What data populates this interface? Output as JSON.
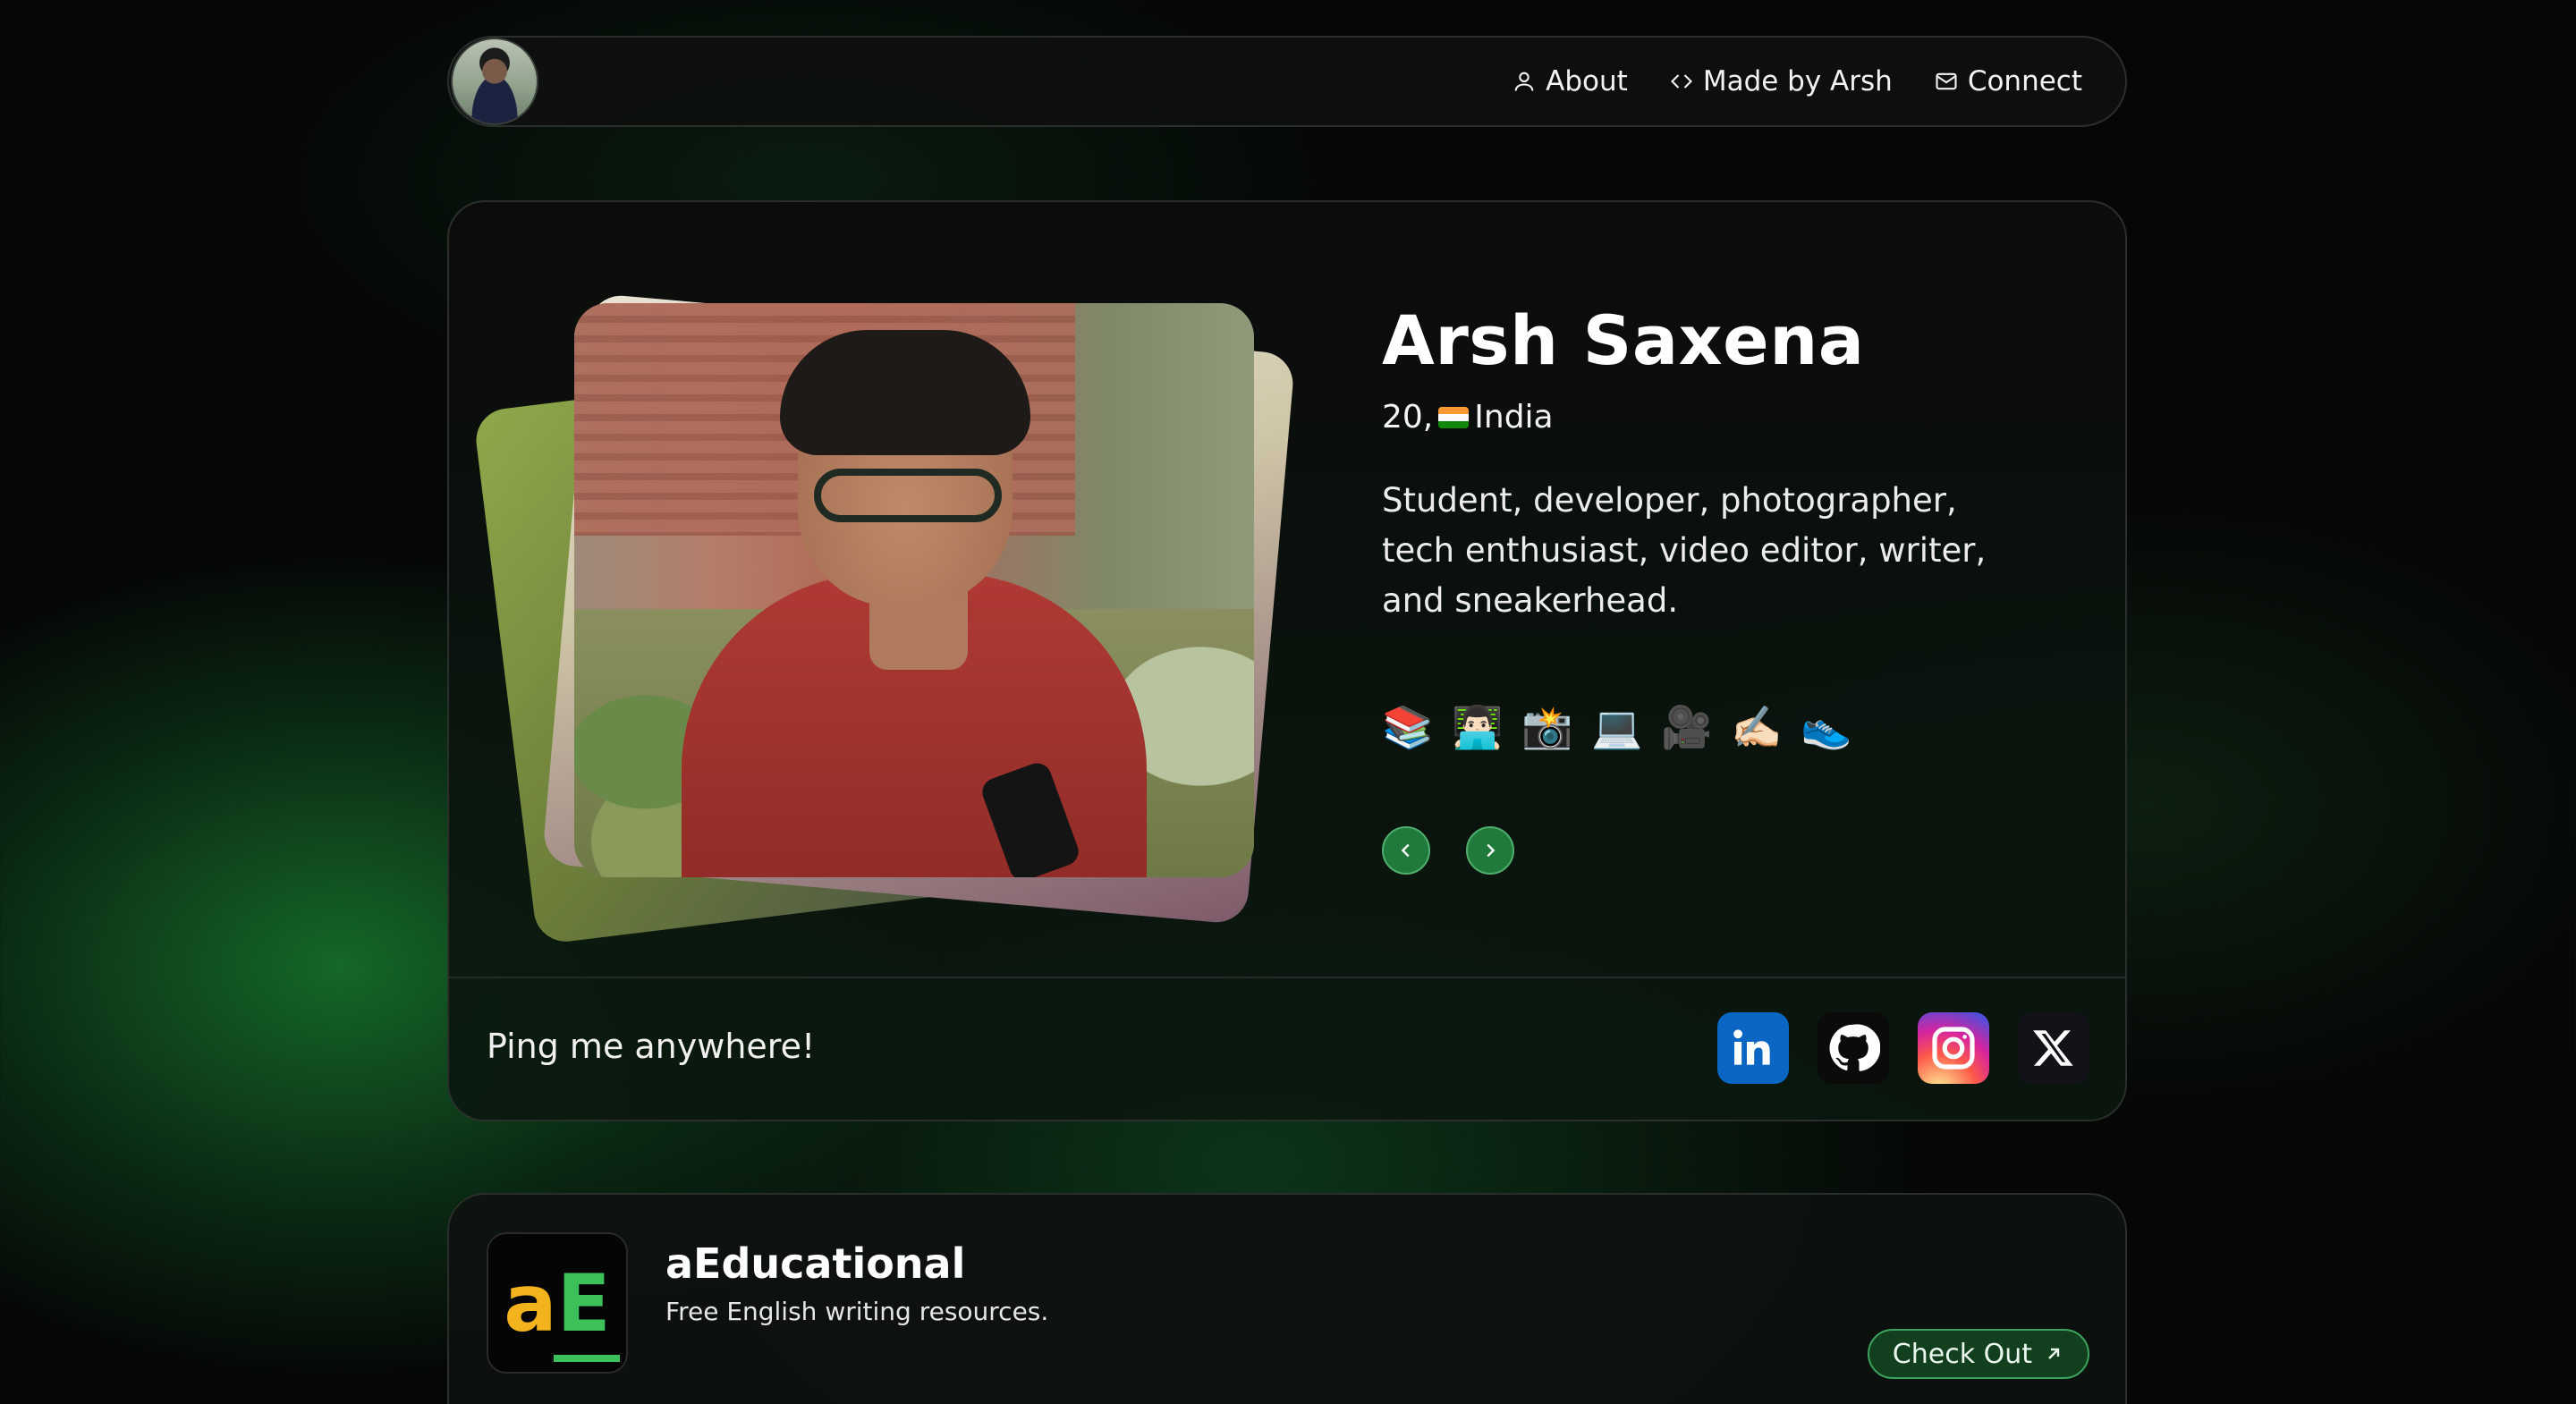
{
  "nav": {
    "avatar_alt": "avatar",
    "links": [
      {
        "label": "About",
        "icon": "user-icon"
      },
      {
        "label": "Made by Arsh",
        "icon": "code-icon"
      },
      {
        "label": "Connect",
        "icon": "mail-icon"
      }
    ]
  },
  "profile": {
    "name": "Arsh Saxena",
    "age_prefix": "20,",
    "country": "India",
    "bio": "Student, developer, photographer, tech enthusiast, video editor, writer, and sneakerhead.",
    "emojis": [
      "📚",
      "👨🏻‍💻",
      "📸",
      "💻",
      "🎥",
      "✍🏻",
      "👟"
    ]
  },
  "connect": {
    "label": "Ping me anywhere!",
    "socials": [
      {
        "name": "LinkedIn",
        "icon": "linkedin-icon"
      },
      {
        "name": "GitHub",
        "icon": "github-icon"
      },
      {
        "name": "Instagram",
        "icon": "instagram-icon"
      },
      {
        "name": "X",
        "icon": "x-icon"
      }
    ]
  },
  "project": {
    "logo_a": "a",
    "logo_e": "E",
    "title": "aEducational",
    "description": "Free English writing resources.",
    "cta": "Check Out"
  },
  "colors": {
    "accent_green": "#1f7a3c",
    "background": "#050705",
    "logo_yellow": "#f2b31c",
    "logo_green": "#3cc05a"
  }
}
